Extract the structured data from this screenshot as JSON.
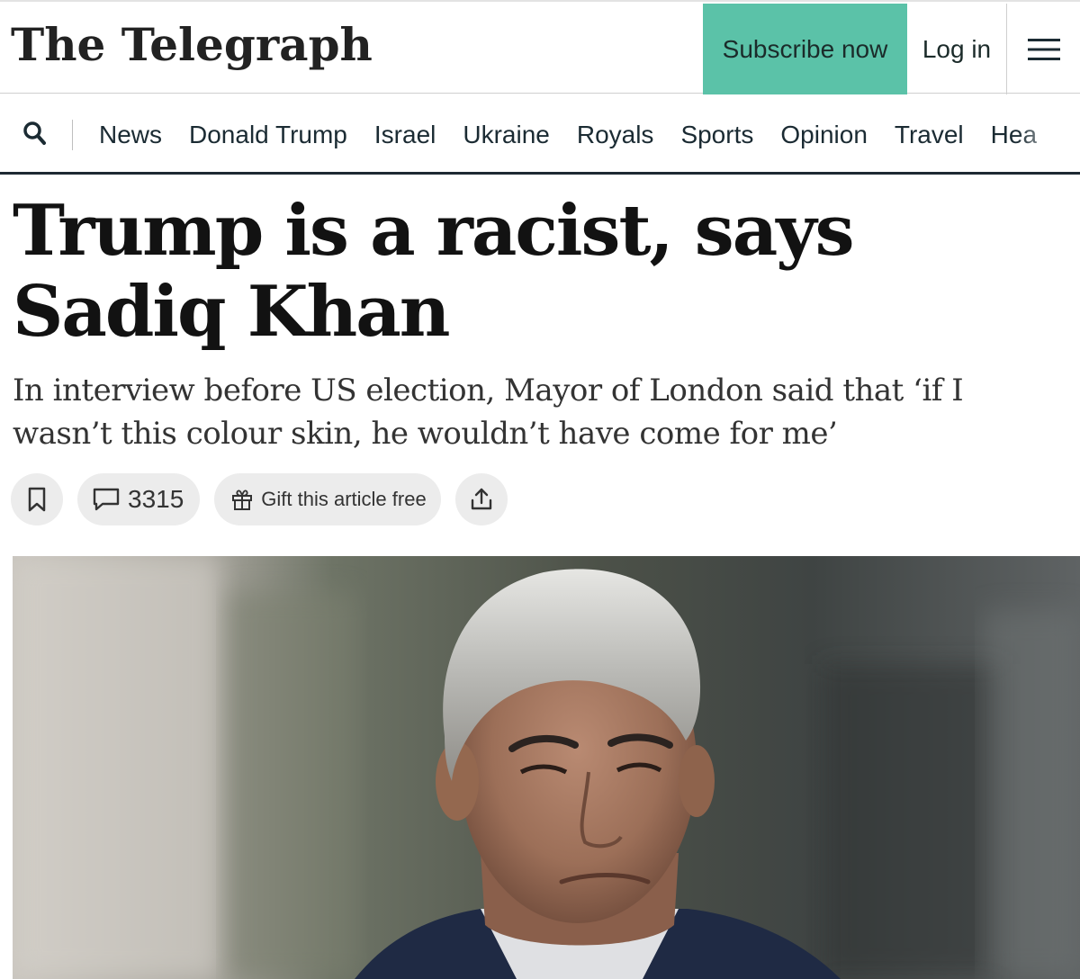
{
  "header": {
    "logo": "The Telegraph",
    "subscribe_label": "Subscribe now",
    "login_label": "Log in",
    "menu_icon": "hamburger-menu-icon",
    "accent_color": "#5bc2a8"
  },
  "nav": {
    "search_icon": "search-icon",
    "items": [
      "News",
      "Donald Trump",
      "Israel",
      "Ukraine",
      "Royals",
      "Sports",
      "Opinion",
      "Travel",
      "Hea"
    ]
  },
  "article": {
    "headline": "Trump is a racist, says Sadiq Khan",
    "standfirst": "In interview before US election, Mayor of London said that ‘if I wasn’t this colour skin, he wouldn’t have come for me’",
    "actions": {
      "bookmark_icon": "bookmark-icon",
      "comment_icon": "comment-icon",
      "comment_count": "3315",
      "gift_icon": "gift-icon",
      "gift_label": "Gift this article free",
      "share_icon": "share-icon"
    }
  }
}
